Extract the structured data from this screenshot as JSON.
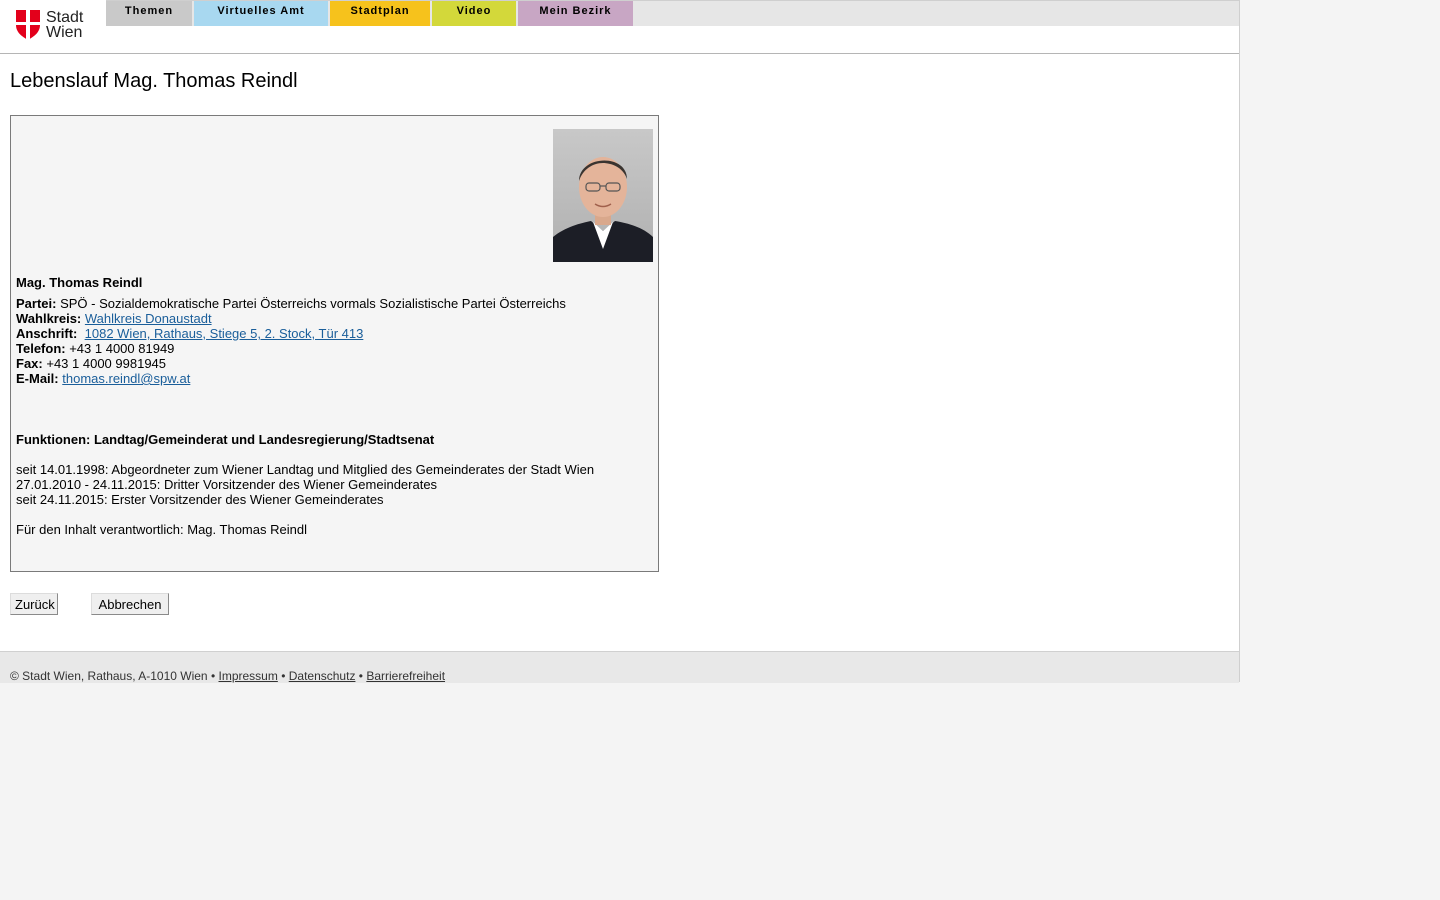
{
  "header": {
    "logo_text": [
      "Stadt",
      "Wien"
    ],
    "nav": [
      "Themen",
      "Virtuelles Amt",
      "Stadtplan",
      "Video",
      "Mein Bezirk"
    ]
  },
  "page_title": "Lebenslauf Mag. Thomas Reindl",
  "profile": {
    "name": "Mag. Thomas Reindl",
    "party_label": "Partei:",
    "party": "SPÖ - Sozialdemokratische Partei Österreichs vormals Sozialistische Partei Österreichs",
    "district_label": "Wahlkreis:",
    "district": "Wahlkreis Donaustadt",
    "address_label": "Anschrift:",
    "address": "1082 Wien, Rathaus, Stiege 5, 2. Stock, Tür 413",
    "phone_label": "Telefon:",
    "phone": "+43 1 4000 81949",
    "fax_label": "Fax:",
    "fax": "+43 1 4000 9981945",
    "email_label": "E-Mail:",
    "email": "thomas.reindl@spw.at"
  },
  "functions": {
    "heading": "Funktionen: Landtag/Gemeinderat und Landesregierung/Stadtsenat",
    "items": [
      "seit 14.01.1998: Abgeordneter zum Wiener Landtag und Mitglied des Gemeinderates der Stadt Wien",
      "27.01.2010 - 24.11.2015: Dritter Vorsitzender des Wiener Gemeinderates",
      "seit 24.11.2015: Erster Vorsitzender des Wiener Gemeinderates"
    ]
  },
  "responsible": "Für den Inhalt verantwortlich: Mag. Thomas Reindl",
  "buttons": {
    "back": "Zurück",
    "cancel": "Abbrechen"
  },
  "footer": {
    "copyright": "© Stadt Wien, Rathaus, A-1010 Wien",
    "separator": "•",
    "links": [
      "Impressum",
      "Datenschutz",
      "Barrierefreiheit"
    ]
  },
  "colors": {
    "tab_themen": "#c9c9c9",
    "tab_amt": "#a8d8f0",
    "tab_stadtplan": "#f6c21c",
    "tab_video": "#d3d83a",
    "tab_bezirk": "#c8a6c4",
    "logo_red": "#e3001b",
    "link": "#1a5e9a"
  },
  "icons": {
    "logo": "wien-shield-icon",
    "portrait": "portrait-photo"
  }
}
